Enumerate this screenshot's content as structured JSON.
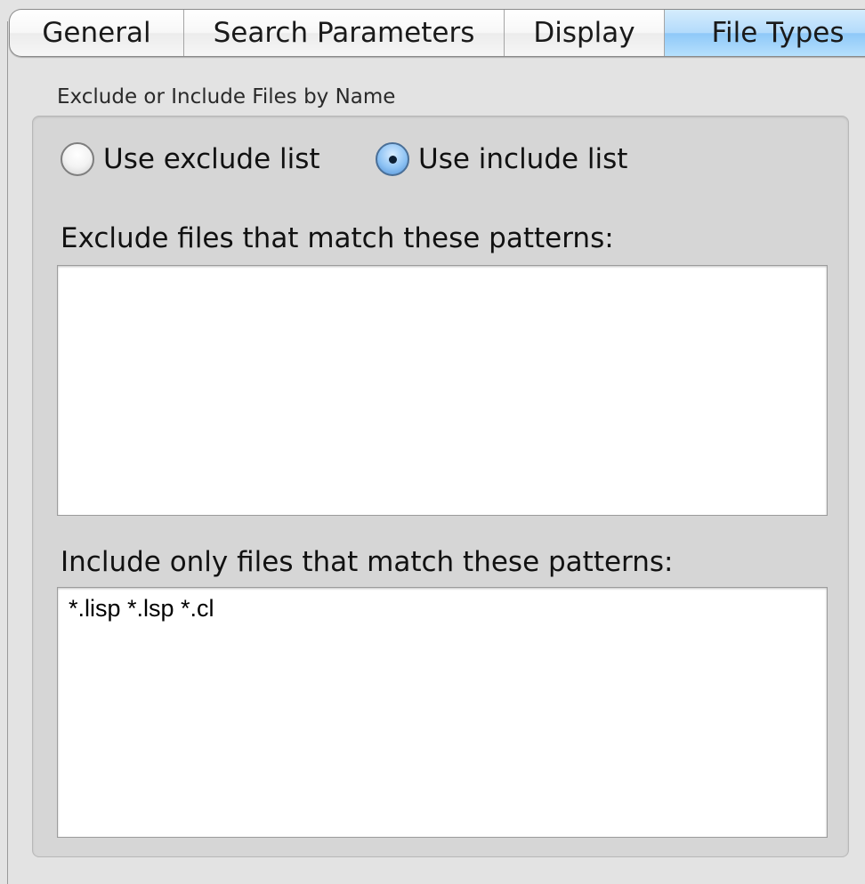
{
  "tabs": [
    {
      "label": "General",
      "active": false
    },
    {
      "label": "Search Parameters",
      "active": false
    },
    {
      "label": "Display",
      "active": false
    },
    {
      "label": "File Types",
      "active": true
    }
  ],
  "group": {
    "title": "Exclude or Include Files by Name"
  },
  "mode": {
    "exclude_label": "Use exclude list",
    "include_label": "Use include list",
    "selected": "include"
  },
  "exclude": {
    "label": "Exclude files that match these patterns:",
    "value": ""
  },
  "include": {
    "label": "Include only files that match these patterns:",
    "value": "*.lisp *.lsp *.cl"
  },
  "colors": {
    "active_tab": "#8ec8f8",
    "panel": "#d6d6d6",
    "window": "#e3e3e3"
  }
}
